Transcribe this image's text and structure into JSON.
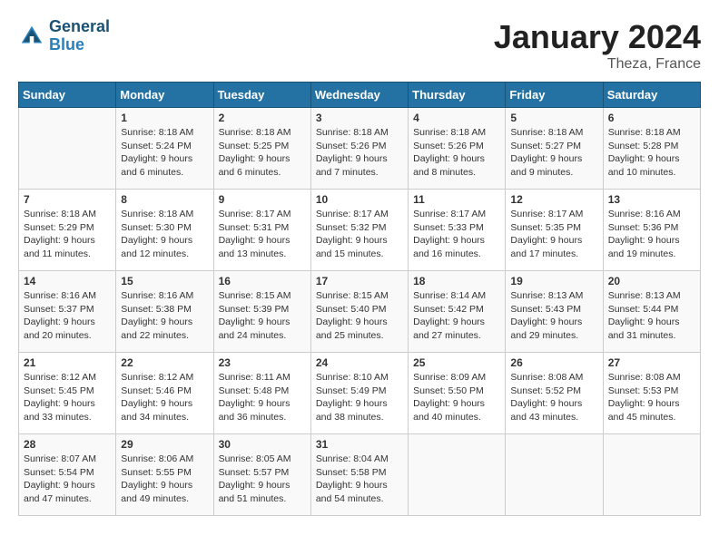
{
  "header": {
    "logo_line1": "General",
    "logo_line2": "Blue",
    "month": "January 2024",
    "location": "Theza, France"
  },
  "days_of_week": [
    "Sunday",
    "Monday",
    "Tuesday",
    "Wednesday",
    "Thursday",
    "Friday",
    "Saturday"
  ],
  "weeks": [
    [
      {
        "day": "",
        "sunrise": "",
        "sunset": "",
        "daylight": ""
      },
      {
        "day": "1",
        "sunrise": "8:18 AM",
        "sunset": "5:24 PM",
        "daylight": "9 hours and 6 minutes."
      },
      {
        "day": "2",
        "sunrise": "8:18 AM",
        "sunset": "5:25 PM",
        "daylight": "9 hours and 6 minutes."
      },
      {
        "day": "3",
        "sunrise": "8:18 AM",
        "sunset": "5:26 PM",
        "daylight": "9 hours and 7 minutes."
      },
      {
        "day": "4",
        "sunrise": "8:18 AM",
        "sunset": "5:26 PM",
        "daylight": "9 hours and 8 minutes."
      },
      {
        "day": "5",
        "sunrise": "8:18 AM",
        "sunset": "5:27 PM",
        "daylight": "9 hours and 9 minutes."
      },
      {
        "day": "6",
        "sunrise": "8:18 AM",
        "sunset": "5:28 PM",
        "daylight": "9 hours and 10 minutes."
      }
    ],
    [
      {
        "day": "7",
        "sunrise": "8:18 AM",
        "sunset": "5:29 PM",
        "daylight": "9 hours and 11 minutes."
      },
      {
        "day": "8",
        "sunrise": "8:18 AM",
        "sunset": "5:30 PM",
        "daylight": "9 hours and 12 minutes."
      },
      {
        "day": "9",
        "sunrise": "8:17 AM",
        "sunset": "5:31 PM",
        "daylight": "9 hours and 13 minutes."
      },
      {
        "day": "10",
        "sunrise": "8:17 AM",
        "sunset": "5:32 PM",
        "daylight": "9 hours and 15 minutes."
      },
      {
        "day": "11",
        "sunrise": "8:17 AM",
        "sunset": "5:33 PM",
        "daylight": "9 hours and 16 minutes."
      },
      {
        "day": "12",
        "sunrise": "8:17 AM",
        "sunset": "5:35 PM",
        "daylight": "9 hours and 17 minutes."
      },
      {
        "day": "13",
        "sunrise": "8:16 AM",
        "sunset": "5:36 PM",
        "daylight": "9 hours and 19 minutes."
      }
    ],
    [
      {
        "day": "14",
        "sunrise": "8:16 AM",
        "sunset": "5:37 PM",
        "daylight": "9 hours and 20 minutes."
      },
      {
        "day": "15",
        "sunrise": "8:16 AM",
        "sunset": "5:38 PM",
        "daylight": "9 hours and 22 minutes."
      },
      {
        "day": "16",
        "sunrise": "8:15 AM",
        "sunset": "5:39 PM",
        "daylight": "9 hours and 24 minutes."
      },
      {
        "day": "17",
        "sunrise": "8:15 AM",
        "sunset": "5:40 PM",
        "daylight": "9 hours and 25 minutes."
      },
      {
        "day": "18",
        "sunrise": "8:14 AM",
        "sunset": "5:42 PM",
        "daylight": "9 hours and 27 minutes."
      },
      {
        "day": "19",
        "sunrise": "8:13 AM",
        "sunset": "5:43 PM",
        "daylight": "9 hours and 29 minutes."
      },
      {
        "day": "20",
        "sunrise": "8:13 AM",
        "sunset": "5:44 PM",
        "daylight": "9 hours and 31 minutes."
      }
    ],
    [
      {
        "day": "21",
        "sunrise": "8:12 AM",
        "sunset": "5:45 PM",
        "daylight": "9 hours and 33 minutes."
      },
      {
        "day": "22",
        "sunrise": "8:12 AM",
        "sunset": "5:46 PM",
        "daylight": "9 hours and 34 minutes."
      },
      {
        "day": "23",
        "sunrise": "8:11 AM",
        "sunset": "5:48 PM",
        "daylight": "9 hours and 36 minutes."
      },
      {
        "day": "24",
        "sunrise": "8:10 AM",
        "sunset": "5:49 PM",
        "daylight": "9 hours and 38 minutes."
      },
      {
        "day": "25",
        "sunrise": "8:09 AM",
        "sunset": "5:50 PM",
        "daylight": "9 hours and 40 minutes."
      },
      {
        "day": "26",
        "sunrise": "8:08 AM",
        "sunset": "5:52 PM",
        "daylight": "9 hours and 43 minutes."
      },
      {
        "day": "27",
        "sunrise": "8:08 AM",
        "sunset": "5:53 PM",
        "daylight": "9 hours and 45 minutes."
      }
    ],
    [
      {
        "day": "28",
        "sunrise": "8:07 AM",
        "sunset": "5:54 PM",
        "daylight": "9 hours and 47 minutes."
      },
      {
        "day": "29",
        "sunrise": "8:06 AM",
        "sunset": "5:55 PM",
        "daylight": "9 hours and 49 minutes."
      },
      {
        "day": "30",
        "sunrise": "8:05 AM",
        "sunset": "5:57 PM",
        "daylight": "9 hours and 51 minutes."
      },
      {
        "day": "31",
        "sunrise": "8:04 AM",
        "sunset": "5:58 PM",
        "daylight": "9 hours and 54 minutes."
      },
      {
        "day": "",
        "sunrise": "",
        "sunset": "",
        "daylight": ""
      },
      {
        "day": "",
        "sunrise": "",
        "sunset": "",
        "daylight": ""
      },
      {
        "day": "",
        "sunrise": "",
        "sunset": "",
        "daylight": ""
      }
    ]
  ]
}
